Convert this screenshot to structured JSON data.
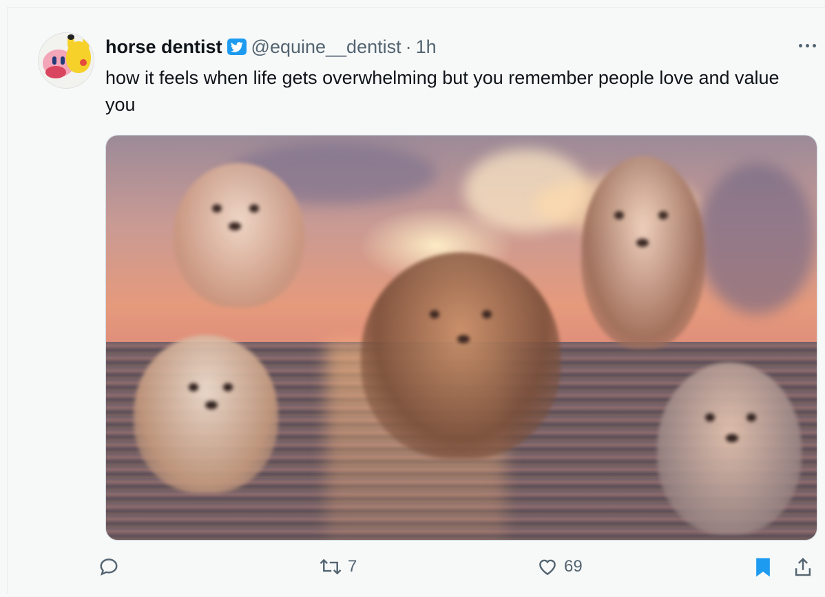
{
  "tweet": {
    "author_name": "horse dentist",
    "handle": "@equine__dentist",
    "separator": "·",
    "time": "1h",
    "text": "how it feels when life gets overwhelming but you remember people love and value you"
  },
  "actions": {
    "retweet_count": "7",
    "like_count": "69"
  },
  "colors": {
    "verified_badge": "#1d9bf0",
    "bookmark_active": "#1d9bf0",
    "secondary_text": "#536471"
  },
  "icons": [
    "reply-icon",
    "retweet-icon",
    "like-icon",
    "bookmark-icon",
    "share-icon",
    "more-icon",
    "verified-icon"
  ]
}
